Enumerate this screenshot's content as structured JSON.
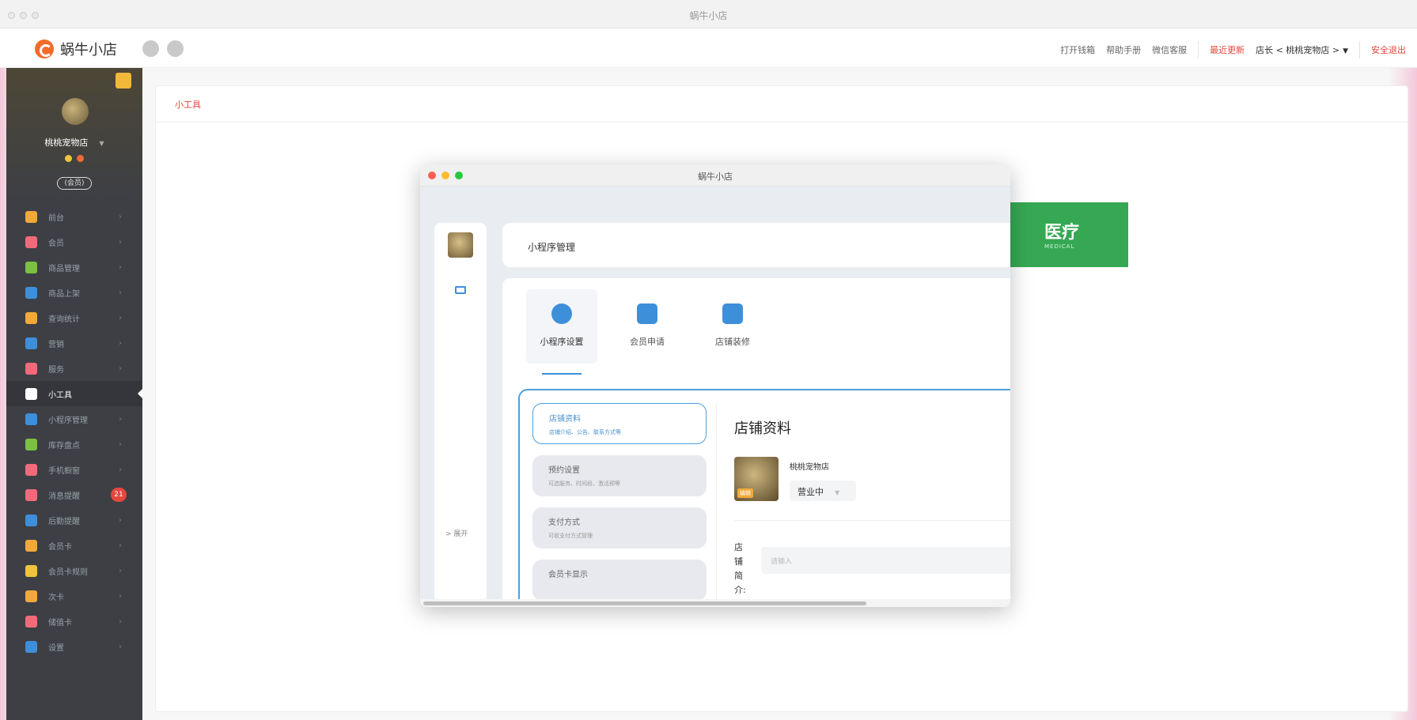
{
  "window": {
    "title": "蜗牛小店"
  },
  "app": {
    "logo_text": "蜗牛小店"
  },
  "topbar": {
    "links": [
      "打开钱箱",
      "帮助手册",
      "微信客服"
    ],
    "recent_update": "最近更新",
    "store_selector": "店长 < 桃桃宠物店 >",
    "logout": "安全退出"
  },
  "profile": {
    "shop_name": "桃桃宠物店",
    "tag": "(会员)"
  },
  "sidebar": {
    "items": [
      {
        "label": "前台",
        "color": "#f0a93a"
      },
      {
        "label": "会员",
        "color": "#f06b7a"
      },
      {
        "label": "商品管理",
        "color": "#7cc043"
      },
      {
        "label": "商品上架",
        "color": "#3e8fd9"
      },
      {
        "label": "查询统计",
        "color": "#f0a93a"
      },
      {
        "label": "营销",
        "color": "#3e8fd9"
      },
      {
        "label": "服务",
        "color": "#f06b7a"
      },
      {
        "label": "小工具",
        "color": "#ffffff",
        "active": true
      },
      {
        "label": "小程序管理",
        "color": "#3e8fd9"
      },
      {
        "label": "库存盘点",
        "color": "#7cc043"
      },
      {
        "label": "手机橱窗",
        "color": "#f06b7a"
      },
      {
        "label": "消息提醒",
        "color": "#f06b7a",
        "count": "21"
      },
      {
        "label": "后勤提醒",
        "color": "#3e8fd9"
      },
      {
        "label": "会员卡",
        "color": "#f0a93a"
      },
      {
        "label": "会员卡规则",
        "color": "#f0c43a"
      },
      {
        "label": "次卡",
        "color": "#f0a93a"
      },
      {
        "label": "储值卡",
        "color": "#f06b7a"
      },
      {
        "label": "设置",
        "color": "#3e8fd9"
      }
    ]
  },
  "content": {
    "breadcrumb": "小工具"
  },
  "medical": {
    "title": "医疗",
    "subtitle": "MEDICAL"
  },
  "mini_window": {
    "title": "蜗牛小店",
    "header": "小程序管理",
    "expand": "> 展开",
    "tabs": [
      {
        "label": "小程序设置",
        "active": true
      },
      {
        "label": "会员申请"
      },
      {
        "label": "店铺装修"
      }
    ],
    "options": [
      {
        "title": "店铺资料",
        "subtitle": "店铺介绍、公告、联系方式等",
        "active": true
      },
      {
        "title": "预约设置",
        "subtitle": "可选服务、时间段、激活预等"
      },
      {
        "title": "支付方式",
        "subtitle": "可收支付方式管理"
      },
      {
        "title": "会员卡显示",
        "subtitle": ""
      }
    ],
    "info": {
      "title": "店铺资料",
      "shop_name": "桃桃宠物店",
      "img_tag": "编辑",
      "status": "营业中",
      "intro_label": "店铺简介:",
      "intro_placeholder": "请输入"
    }
  }
}
